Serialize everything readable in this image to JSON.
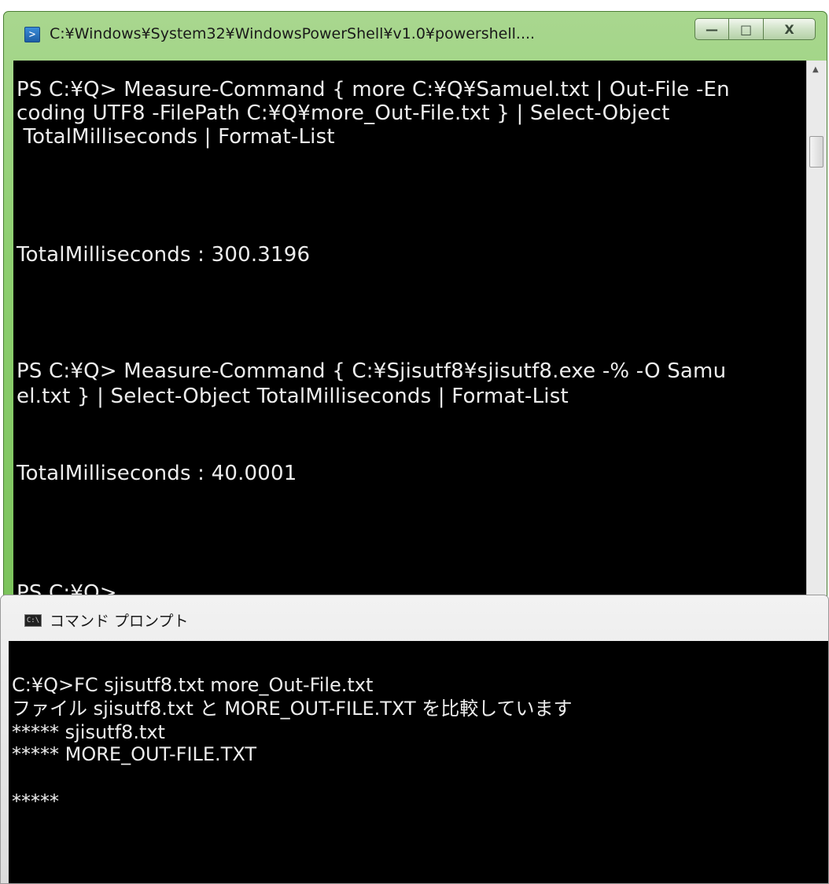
{
  "powershell": {
    "title": "C:¥Windows¥System32¥WindowsPowerShell¥v1.0¥powershell....",
    "icon": "powershell-icon",
    "controls": {
      "minimize": "—",
      "maximize": "□",
      "close": "X"
    },
    "lines": [
      "PS C:¥Q> Measure-Command { more C:¥Q¥Samuel.txt | Out-File -En",
      "coding UTF8 -FilePath C:¥Q¥more_Out-File.txt } | Select-Object",
      " TotalMilliseconds | Format-List",
      "TotalMilliseconds : 300.3196",
      "PS C:¥Q> Measure-Command { C:¥Sjisutf8¥sjisutf8.exe -% -O Samu",
      "el.txt } | Select-Object TotalMilliseconds | Format-List",
      "TotalMilliseconds : 40.0001",
      "PS C:¥Q>"
    ]
  },
  "cmd": {
    "title": "コマンド プロンプト",
    "icon": "cmd-icon",
    "icon_text": "C:\\",
    "lines": [
      "C:¥Q>FC sjisutf8.txt more_Out-File.txt",
      "ファイル sjisutf8.txt と MORE_OUT-FILE.TXT を比較しています",
      "***** sjisutf8.txt",
      "***** MORE_OUT-FILE.TXT",
      "*****"
    ]
  },
  "colors": {
    "console_bg": "#000000",
    "console_fg": "#ededed",
    "ps_frame": "#8fcf71",
    "cmd_frame": "#dcdcdc"
  }
}
